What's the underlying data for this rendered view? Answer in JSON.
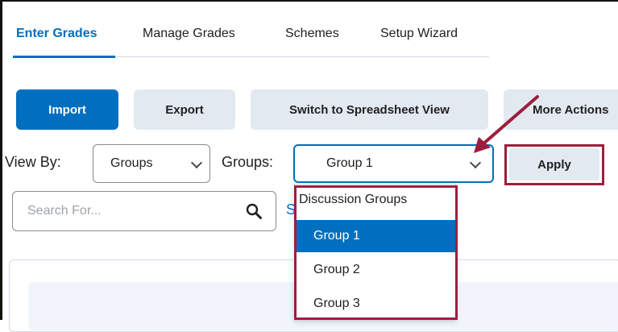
{
  "tabs": [
    {
      "label": "Enter Grades",
      "active": true
    },
    {
      "label": "Manage Grades",
      "active": false
    },
    {
      "label": "Schemes",
      "active": false
    },
    {
      "label": "Setup Wizard",
      "active": false
    }
  ],
  "toolbar": {
    "import_label": "Import",
    "export_label": "Export",
    "spreadsheet_label": "Switch to Spreadsheet View",
    "more_actions_label": "More Actions"
  },
  "view_by": {
    "label": "View By:",
    "value": "Groups"
  },
  "groups": {
    "label": "Groups:",
    "value": "Group 1"
  },
  "apply_label": "Apply",
  "search": {
    "placeholder": "Search For...",
    "link_fragment": "S"
  },
  "dropdown": {
    "header": "Discussion Groups",
    "options": [
      "Group 1",
      "Group 2",
      "Group 3"
    ],
    "selected": "Group 1"
  },
  "colors": {
    "accent": "#006fbf",
    "highlight": "#9d1e3d",
    "secondary_bg": "#e3e9f1"
  }
}
